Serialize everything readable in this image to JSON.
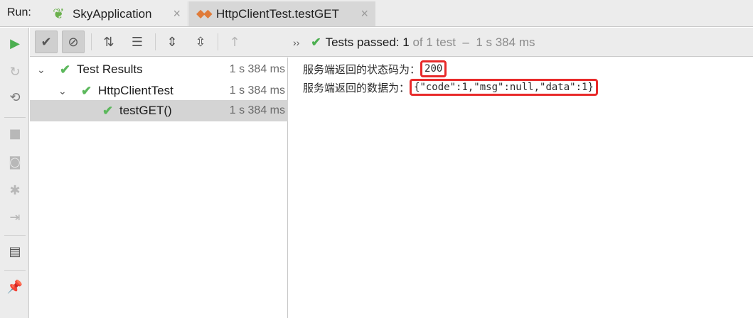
{
  "run_label": "Run:",
  "tabs": [
    {
      "label": "SkyApplication",
      "icon": "spring-boot-icon",
      "close": "×"
    },
    {
      "label": "HttpClientTest.testGET",
      "icon": "test-diamond-icon",
      "close": "×"
    }
  ],
  "status": {
    "chevron": "››",
    "passed_label": "Tests passed:",
    "passed_count": "1",
    "of_total": "of 1 test",
    "dash": "–",
    "duration": "1 s 384 ms"
  },
  "tree": [
    {
      "label": "Test Results",
      "time": "1 s 384 ms",
      "level": 0,
      "expanded": true
    },
    {
      "label": "HttpClientTest",
      "time": "1 s 384 ms",
      "level": 1,
      "expanded": true
    },
    {
      "label": "testGET()",
      "time": "1 s 384 ms",
      "level": 2,
      "selected": true
    }
  ],
  "console": {
    "line1_prefix": "服务端返回的状态码为：",
    "line1_value": "200",
    "line2_prefix": "服务端返回的数据为：",
    "line2_value": "{\"code\":1,\"msg\":null,\"data\":1}"
  },
  "colors": {
    "pass_green": "#5cb85c",
    "highlight_red": "#e82a2a"
  }
}
